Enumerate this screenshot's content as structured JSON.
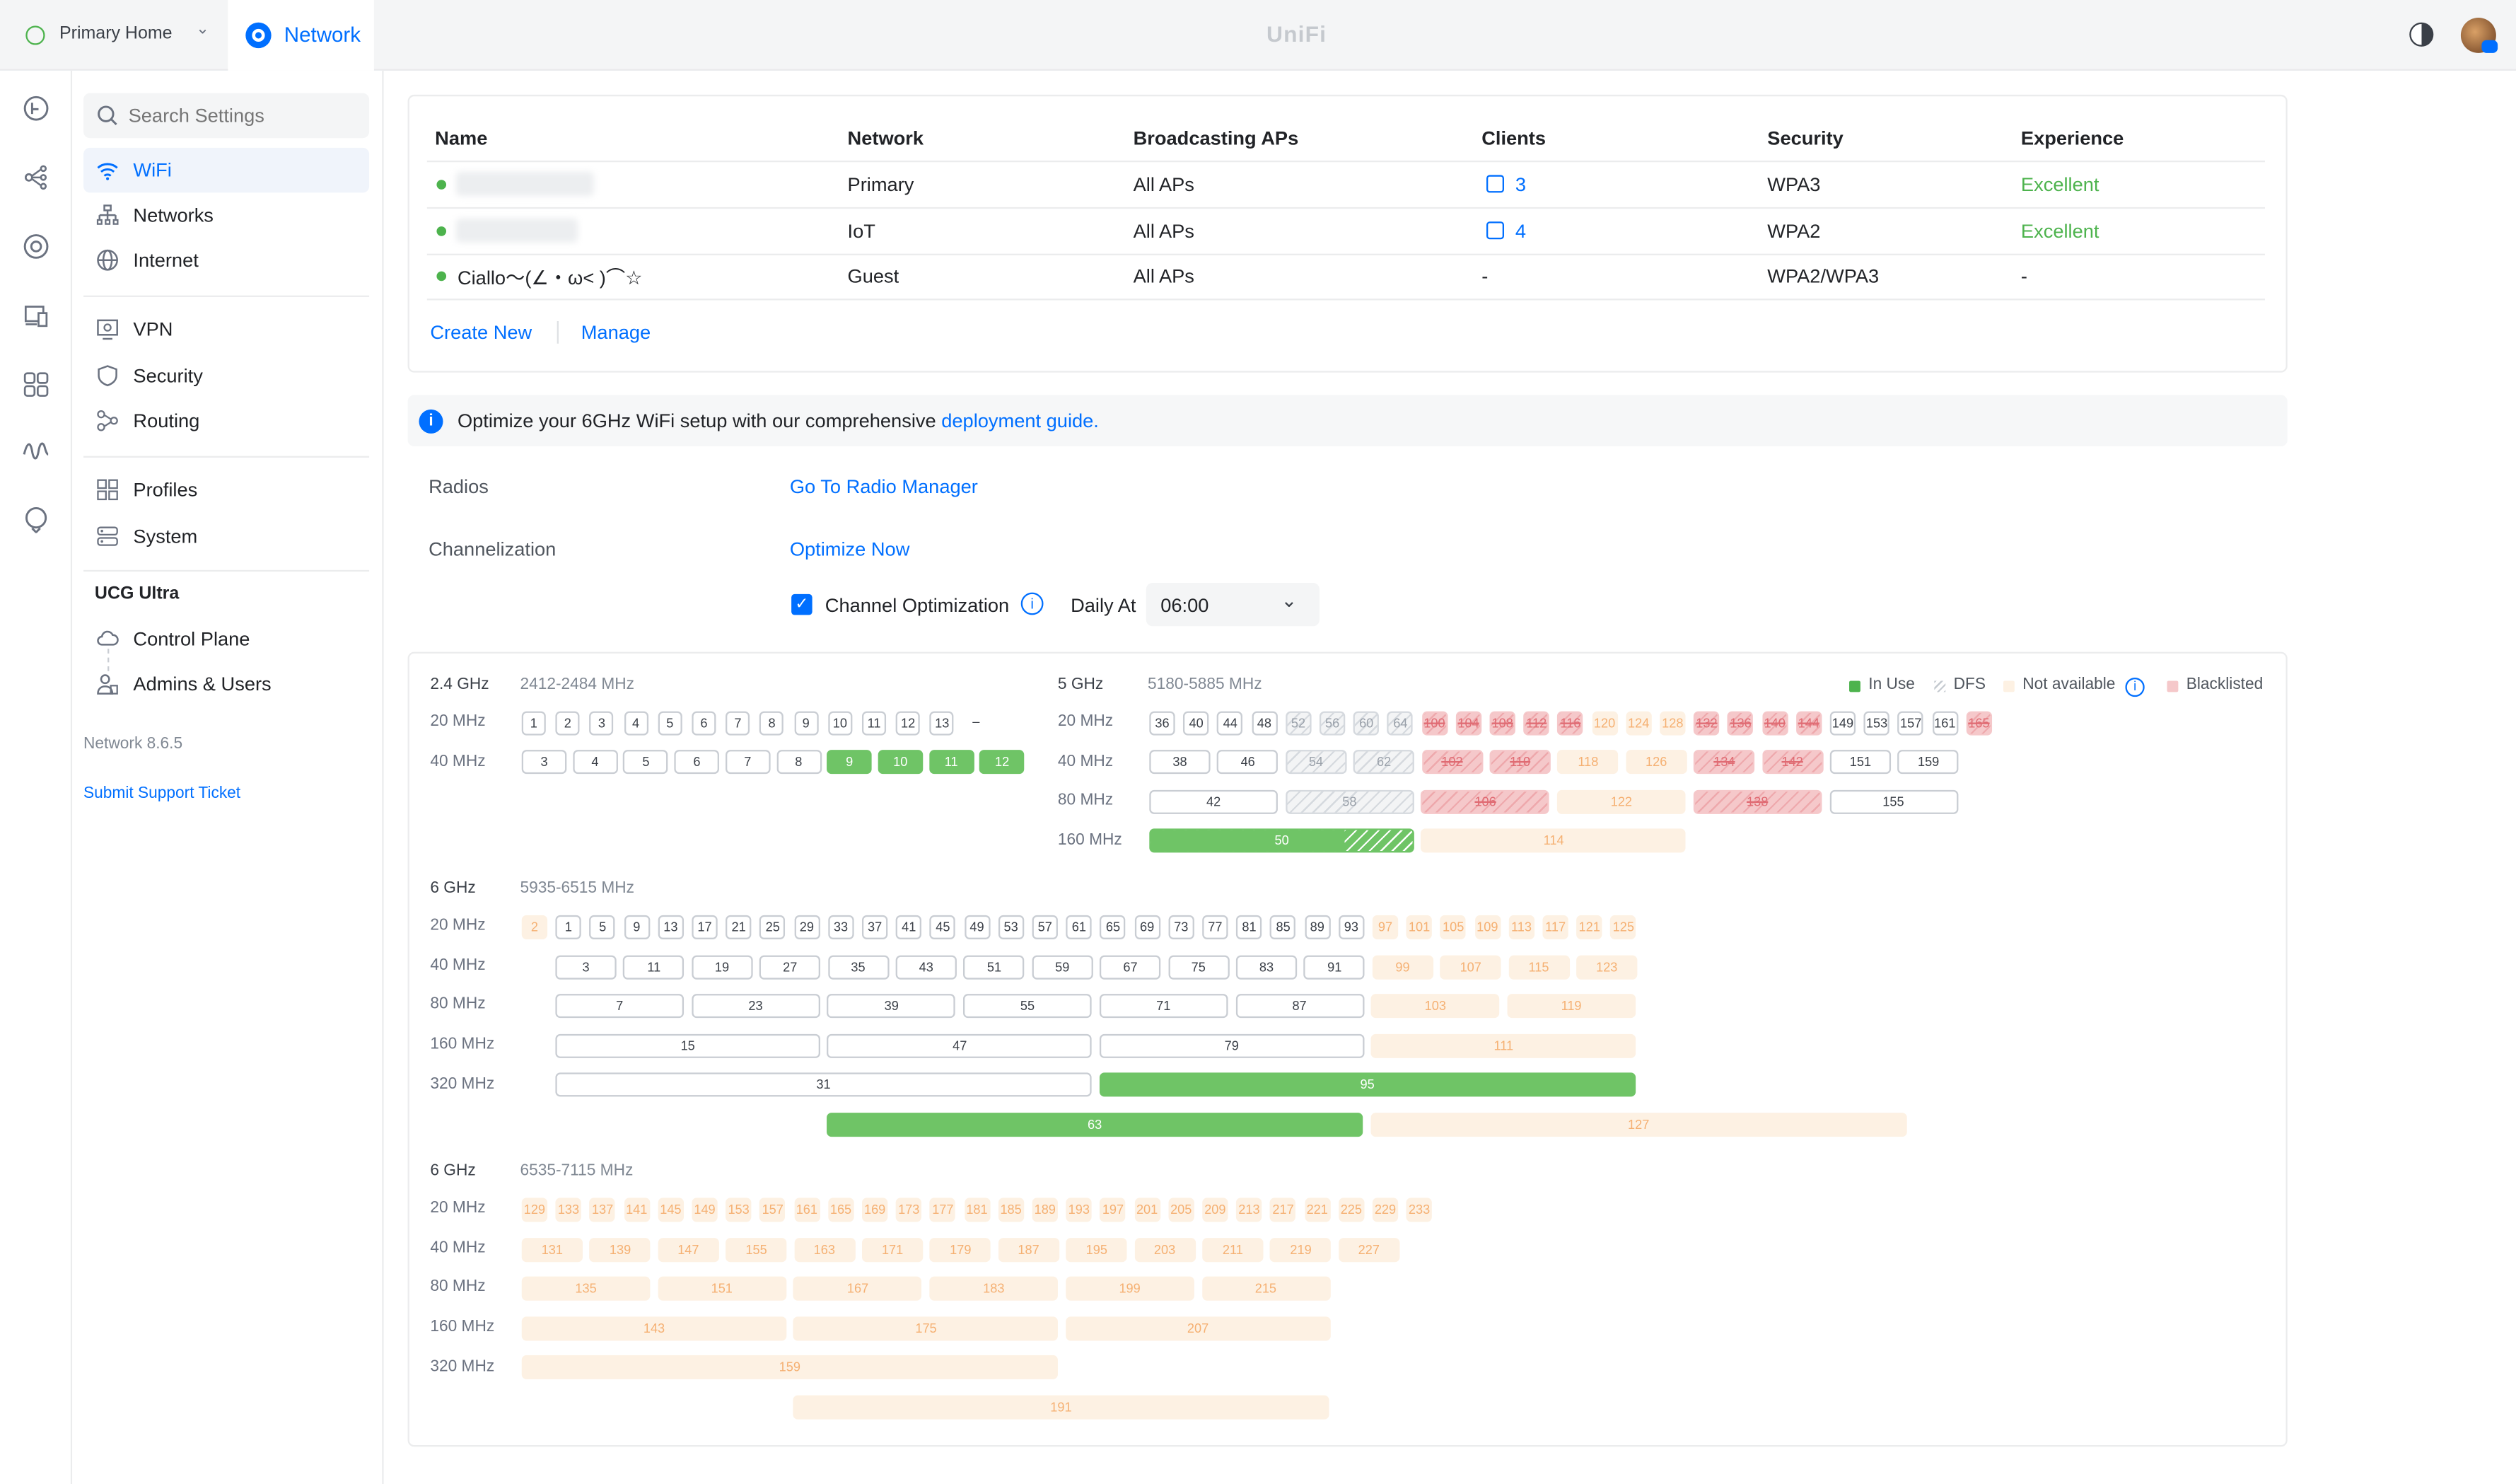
{
  "topbar": {
    "site_selector": "Primary Home",
    "active_app": "Network",
    "brand": "UniFi"
  },
  "sidebar": {
    "search_placeholder": "Search Settings",
    "items": [
      {
        "label": "WiFi",
        "icon": "wifi-icon",
        "active": true
      },
      {
        "label": "Networks",
        "icon": "network-topology-icon"
      },
      {
        "label": "Internet",
        "icon": "globe-icon"
      },
      {
        "label": "VPN",
        "icon": "vpn-icon"
      },
      {
        "label": "Security",
        "icon": "shield-icon"
      },
      {
        "label": "Routing",
        "icon": "routing-icon"
      },
      {
        "label": "Profiles",
        "icon": "profiles-icon"
      },
      {
        "label": "System",
        "icon": "system-icon"
      }
    ],
    "device_section": "UCG Ultra",
    "device_items": [
      {
        "label": "Control Plane",
        "icon": "cloud-icon"
      },
      {
        "label": "Admins & Users",
        "icon": "users-icon"
      }
    ],
    "version": "Network 8.6.5",
    "support_link": "Submit Support Ticket"
  },
  "wifi_table": {
    "headers": [
      "Name",
      "Network",
      "Broadcasting APs",
      "Clients",
      "Security",
      "Experience"
    ],
    "rows": [
      {
        "name": "",
        "network": "Primary",
        "aps": "All APs",
        "clients": "3",
        "security": "WPA3",
        "experience": "Excellent",
        "status_color": "#4db34d"
      },
      {
        "name": "",
        "network": "IoT",
        "aps": "All APs",
        "clients": "4",
        "security": "WPA2",
        "experience": "Excellent",
        "status_color": "#4db34d"
      },
      {
        "name": "Ciallo～(∠・ω< )⌒☆",
        "network": "Guest",
        "aps": "All APs",
        "clients": "-",
        "security": "WPA2/WPA3",
        "experience": "-",
        "status_color": "#4db34d"
      }
    ],
    "create_new": "Create New",
    "manage": "Manage"
  },
  "banner": {
    "text": "Optimize your 6GHz WiFi setup with our comprehensive",
    "link": "deployment guide",
    "suffix": "."
  },
  "radios": {
    "label": "Radios",
    "link": "Go To Radio Manager"
  },
  "channelization": {
    "label": "Channelization",
    "link": "Optimize Now",
    "checkbox_label": "Channel Optimization",
    "checked": true,
    "daily_label": "Daily At",
    "time": "06:00"
  },
  "legend": {
    "in_use": "In Use",
    "dfs": "DFS",
    "not_available": "Not available",
    "blacklisted": "Blacklisted"
  },
  "bands": {
    "b24": {
      "title": "2.4 GHz",
      "range": "2412-2484 MHz",
      "rows": [
        {
          "label": "20 MHz",
          "channels": [
            "1",
            "2",
            "3",
            "4",
            "5",
            "6",
            "7",
            "8",
            "9",
            "10",
            "11",
            "12",
            "13",
            "–"
          ],
          "states": [
            "",
            "",
            "",
            "",
            "",
            "",
            "",
            "",
            "",
            "",
            "",
            "",
            "",
            "dash"
          ]
        },
        {
          "label": "40 MHz",
          "channels": [
            "3",
            "4",
            "5",
            "6",
            "7",
            "8",
            "9",
            "10",
            "11",
            "12"
          ],
          "states": [
            "",
            "",
            "",
            "",
            "",
            "",
            "inuse",
            "inuse",
            "inuse",
            "inuse"
          ]
        }
      ]
    },
    "b5": {
      "title": "5 GHz",
      "range": "5180-5885 MHz",
      "rows": [
        {
          "label": "20 MHz",
          "channels": [
            "36",
            "40",
            "44",
            "48",
            "52",
            "56",
            "60",
            "64",
            "100",
            "104",
            "108",
            "112",
            "116",
            "120",
            "124",
            "128",
            "132",
            "136",
            "140",
            "144",
            "149",
            "153",
            "157",
            "161",
            "165"
          ],
          "states": [
            "",
            "",
            "",
            "",
            "dfs",
            "dfs",
            "dfs",
            "dfs",
            "bl",
            "bl",
            "bl",
            "bl",
            "bl",
            "na",
            "na",
            "na",
            "bl",
            "bl",
            "bl",
            "bl",
            "",
            "",
            "",
            "",
            "bl"
          ]
        },
        {
          "label": "40 MHz",
          "channels": [
            "38",
            "46",
            "54",
            "62",
            "102",
            "110",
            "118",
            "126",
            "134",
            "142",
            "151",
            "159"
          ],
          "states": [
            "",
            "",
            "dfs",
            "dfs",
            "bl",
            "bl",
            "na",
            "na",
            "bl",
            "bl",
            "",
            ""
          ]
        },
        {
          "label": "80 MHz",
          "channels": [
            "42",
            "58",
            "106",
            "122",
            "138",
            "155"
          ],
          "states": [
            "",
            "dfs",
            "bl",
            "na",
            "bl",
            ""
          ]
        },
        {
          "label": "160 MHz",
          "channels": [
            "50",
            "114"
          ],
          "states": [
            "inusedfs",
            "na"
          ]
        }
      ]
    },
    "b6a": {
      "title": "6 GHz",
      "range": "5935-6515 MHz",
      "rows": [
        {
          "label": "20 MHz",
          "channels": [
            "2",
            "1",
            "5",
            "9",
            "13",
            "17",
            "21",
            "25",
            "29",
            "33",
            "37",
            "41",
            "45",
            "49",
            "53",
            "57",
            "61",
            "65",
            "69",
            "73",
            "77",
            "81",
            "85",
            "89",
            "93",
            "97",
            "101",
            "105",
            "109",
            "113",
            "117",
            "121",
            "125"
          ],
          "states": [
            "na",
            "",
            "",
            "",
            "",
            "",
            "",
            "",
            "",
            "",
            "",
            "",
            "",
            "",
            "",
            "",
            "",
            "",
            "",
            "",
            "",
            "",
            "",
            "",
            "",
            "na",
            "na",
            "na",
            "na",
            "na",
            "na",
            "na",
            "na"
          ]
        },
        {
          "label": "40 MHz",
          "channels": [
            "3",
            "11",
            "19",
            "27",
            "35",
            "43",
            "51",
            "59",
            "67",
            "75",
            "83",
            "91",
            "99",
            "107",
            "115",
            "123"
          ],
          "states": [
            "",
            "",
            "",
            "",
            "",
            "",
            "",
            "",
            "",
            "",
            "",
            "",
            "na",
            "na",
            "na",
            "na"
          ]
        },
        {
          "label": "80 MHz",
          "channels": [
            "7",
            "23",
            "39",
            "55",
            "71",
            "87",
            "103",
            "119"
          ],
          "states": [
            "",
            "",
            "",
            "",
            "",
            "",
            "na",
            "na"
          ]
        },
        {
          "label": "160 MHz",
          "channels": [
            "15",
            "47",
            "79",
            "111"
          ],
          "states": [
            "",
            "",
            "",
            "na"
          ]
        },
        {
          "label": "320 MHz",
          "channels": [
            "31",
            "95"
          ],
          "states": [
            "",
            "inuse"
          ]
        },
        {
          "label": "",
          "channels": [
            "63",
            "127"
          ],
          "states": [
            "inuse",
            "na"
          ]
        }
      ]
    },
    "b6b": {
      "title": "6 GHz",
      "range": "6535-7115 MHz",
      "rows": [
        {
          "label": "20 MHz",
          "channels": [
            "129",
            "133",
            "137",
            "141",
            "145",
            "149",
            "153",
            "157",
            "161",
            "165",
            "169",
            "173",
            "177",
            "181",
            "185",
            "189",
            "193",
            "197",
            "201",
            "205",
            "209",
            "213",
            "217",
            "221",
            "225",
            "229",
            "233"
          ],
          "states": "na"
        },
        {
          "label": "40 MHz",
          "channels": [
            "131",
            "139",
            "147",
            "155",
            "163",
            "171",
            "179",
            "187",
            "195",
            "203",
            "211",
            "219",
            "227"
          ],
          "states": "na"
        },
        {
          "label": "80 MHz",
          "channels": [
            "135",
            "151",
            "167",
            "183",
            "199",
            "215"
          ],
          "states": "na"
        },
        {
          "label": "160 MHz",
          "channels": [
            "143",
            "175",
            "207"
          ],
          "states": "na"
        },
        {
          "label": "320 MHz",
          "channels": [
            "159"
          ],
          "states": "na"
        },
        {
          "label": "",
          "channels": [
            "191"
          ],
          "states": "na"
        }
      ]
    }
  }
}
